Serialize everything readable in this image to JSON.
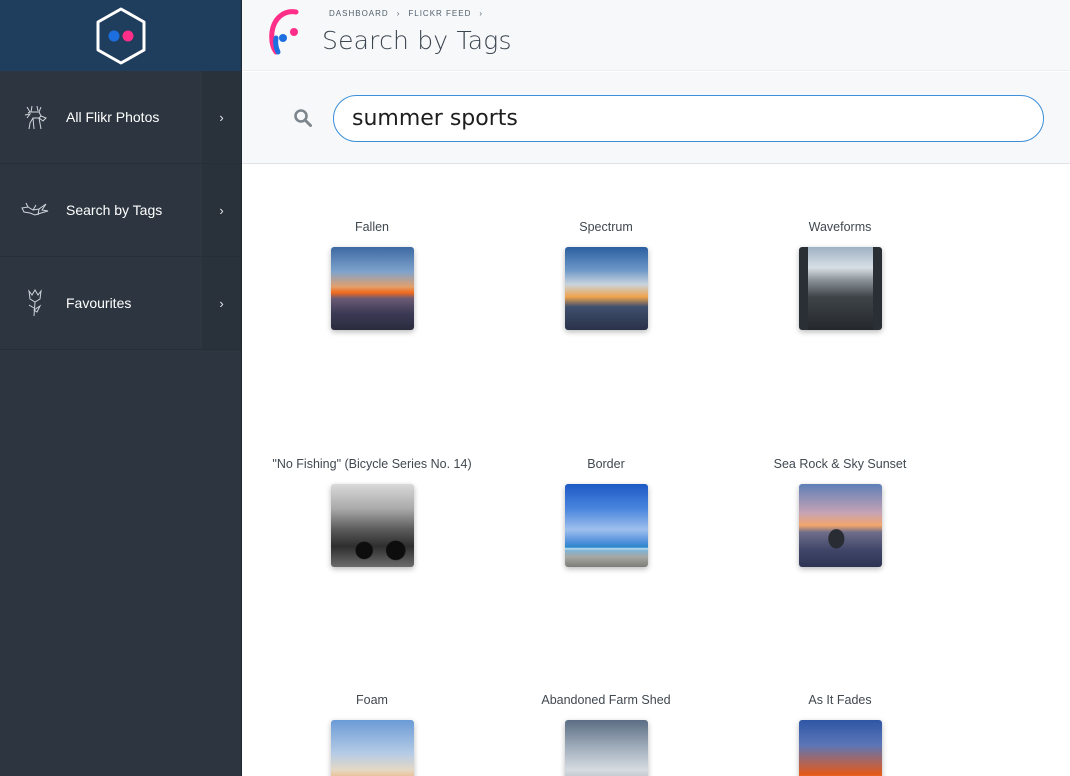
{
  "sidebar": {
    "items": [
      {
        "label": "All Flikr Photos",
        "icon": "deer-icon"
      },
      {
        "label": "Search by Tags",
        "icon": "bird-icon"
      },
      {
        "label": "Favourites",
        "icon": "flower-icon"
      }
    ]
  },
  "header": {
    "breadcrumb": [
      "DASHBOARD",
      "FLICKR FEED"
    ],
    "title": "Search by Tags"
  },
  "search": {
    "value": "summer sports"
  },
  "photos": [
    {
      "title": "Fallen"
    },
    {
      "title": "Spectrum"
    },
    {
      "title": "Waveforms"
    },
    {
      "title": "\"No Fishing\" (Bicycle Series No. 14)"
    },
    {
      "title": "Border"
    },
    {
      "title": "Sea Rock & Sky Sunset"
    },
    {
      "title": "Foam"
    },
    {
      "title": "Abandoned Farm Shed"
    },
    {
      "title": "As It Fades"
    }
  ],
  "colors": {
    "sidebar_bg": "#2d3640",
    "logo_bg": "#1f3d5c",
    "accent_blue": "#3b8fd9",
    "flickr_blue": "#1d6fe0",
    "flickr_pink": "#ff2e88"
  }
}
